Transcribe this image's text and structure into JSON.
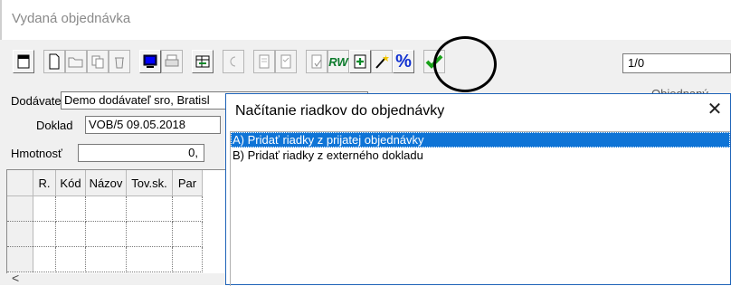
{
  "window": {
    "title": "Vydaná objednávka"
  },
  "toolbar": {
    "buttons": [
      "record-icon",
      "new-icon",
      "open-icon",
      "copy-icon",
      "delete-icon",
      "monitor-icon",
      "print-icon",
      "export-icon",
      "undo-icon",
      "book-icon",
      "list-icon",
      "report-icon",
      "rw-icon",
      "add-row-icon",
      "magic-wand-icon",
      "percent-icon",
      "confirm-icon"
    ],
    "rw_label": "RW",
    "percent_label": "%",
    "page_indicator": "1/0"
  },
  "form": {
    "supplier_label": "Dodávateľ",
    "supplier_value": "Demo dodávateľ sro, Bratisl",
    "doc_label": "Doklad",
    "doc_value": "VOB/5 09.05.2018",
    "weight_label": "Hmotnosť",
    "weight_value": "0,",
    "right_partial_label": "Objednaný"
  },
  "grid": {
    "columns": [
      "R.",
      "Kód",
      "Názov",
      "Tov.sk.",
      "Par"
    ]
  },
  "dialog": {
    "title": "Načítanie riadkov do objednávky",
    "close_label": "✕",
    "items": [
      {
        "label": "A) Pridať riadky z prijatej objednávky",
        "selected": true
      },
      {
        "label": "B) Pridať riadky z externého dokladu",
        "selected": false
      }
    ]
  },
  "colors": {
    "selection": "#0f74d6",
    "dialog_border": "#1e63b8",
    "percent": "#1030d0"
  }
}
